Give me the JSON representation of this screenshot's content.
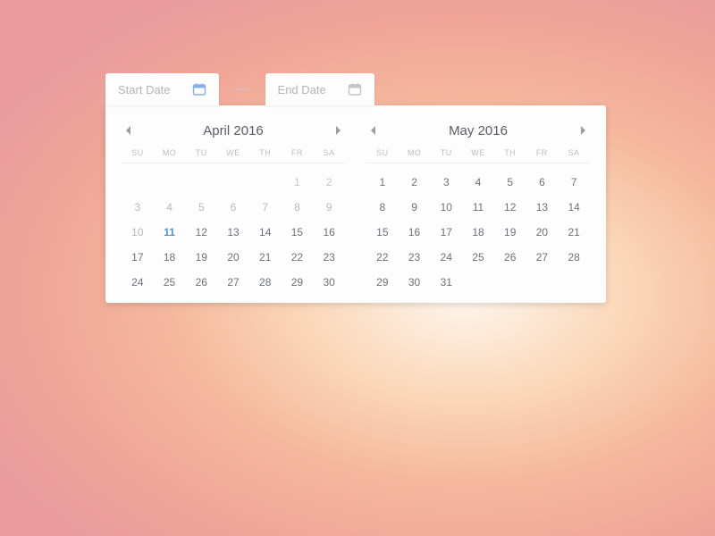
{
  "tabs": {
    "start": "Start Date",
    "end": "End Date",
    "separator": "—"
  },
  "dow": [
    "SU",
    "MO",
    "TU",
    "WE",
    "TH",
    "FR",
    "SA"
  ],
  "calendars": [
    {
      "title": "April 2016",
      "leading_blanks": 5,
      "days": 30,
      "muted_through": 10,
      "today": 11
    },
    {
      "title": "May 2016",
      "leading_blanks": 0,
      "days": 31,
      "muted_through": 0,
      "today": null
    }
  ],
  "icons": {
    "calendar_start_color": "#88b0e5",
    "calendar_end_color": "#c2c5c9"
  }
}
